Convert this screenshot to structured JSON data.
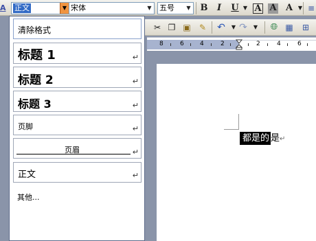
{
  "toolbar": {
    "style_value": "正文",
    "font_value": "宋体",
    "size_value": "五号",
    "bold_label": "B",
    "italic_label": "I",
    "underline_label": "U",
    "char_border_label": "A",
    "char_shading_label": "A",
    "char_spacing_label": "A"
  },
  "ruler": {
    "numbers": [
      "8",
      "6",
      "4",
      "2",
      "2",
      "4",
      "6"
    ]
  },
  "style_dropdown": {
    "clear_format": "清除格式",
    "heading1": "标题 1",
    "heading2": "标题 2",
    "heading3": "标题 3",
    "footer": "页脚",
    "header": "页眉",
    "normal": "正文",
    "more": "其他...",
    "para_mark": "↵"
  },
  "document": {
    "selected_text": "都是的",
    "rest_text": "是",
    "para_mark": "↵"
  },
  "colors": {
    "selection": "#316ac5",
    "dropdown_arrow": "#f09440",
    "app_background": "#8a94a9"
  }
}
